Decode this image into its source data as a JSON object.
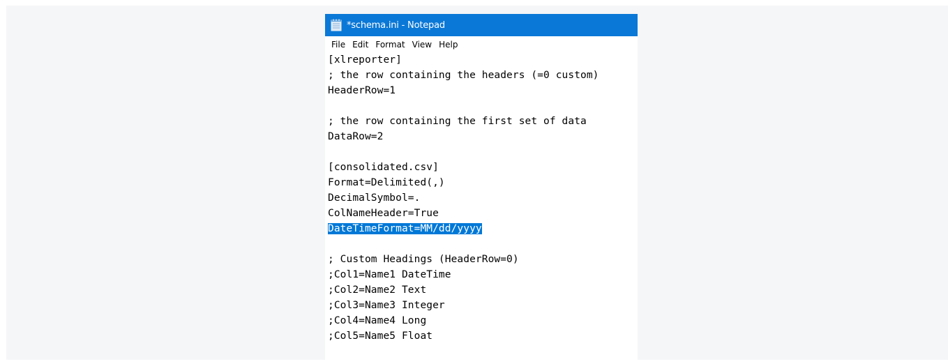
{
  "window": {
    "title": "*schema.ini - Notepad",
    "icon": "notepad-icon"
  },
  "menu": [
    "File",
    "Edit",
    "Format",
    "View",
    "Help"
  ],
  "editor": {
    "lines": [
      "[xlreporter]",
      "; the row containing the headers (=0 custom)",
      "HeaderRow=1",
      "",
      "; the row containing the first set of data",
      "DataRow=2",
      "",
      "[consolidated.csv]",
      "Format=Delimited(,)",
      "DecimalSymbol=.",
      "ColNameHeader=True",
      "DateTimeFormat=MM/dd/yyyy",
      "",
      "; Custom Headings (HeaderRow=0)",
      ";Col1=Name1 DateTime",
      ";Col2=Name2 Text",
      ";Col3=Name3 Integer",
      ";Col4=Name4 Long",
      ";Col5=Name5 Float"
    ],
    "selected_line": "DateTimeFormat=MM/dd/yyyy"
  },
  "colors": {
    "titlebar": "#0a78d7",
    "selection": "#0078d7",
    "background": "#f5f6f8"
  }
}
